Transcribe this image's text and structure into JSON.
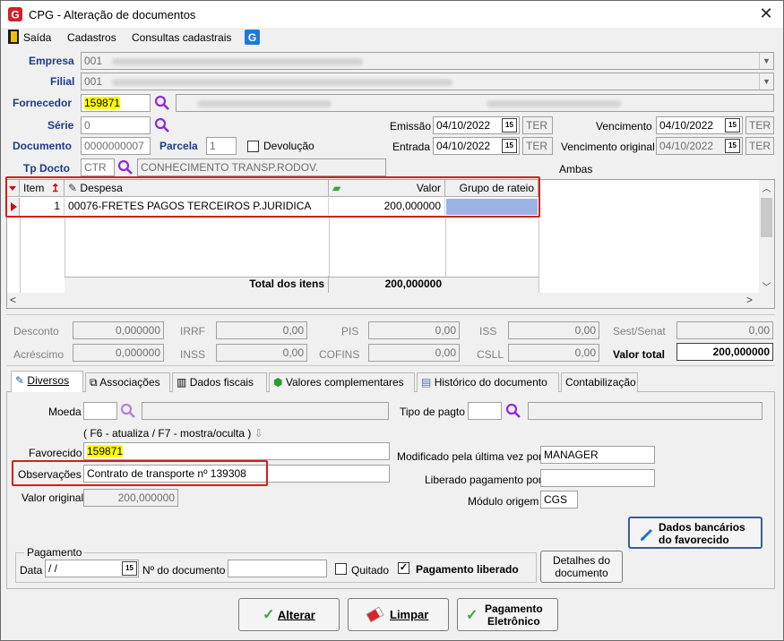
{
  "window": {
    "title": "CPG - Alteração de documentos",
    "close": "✕"
  },
  "menu": {
    "items": [
      "Saída",
      "Cadastros",
      "Consultas cadastrais"
    ]
  },
  "header": {
    "empresa_label": "Empresa",
    "empresa_code": "001",
    "filial_label": "Filial",
    "filial_code": "001",
    "fornecedor_label": "Fornecedor",
    "fornecedor_code": "159871",
    "serie_label": "Série",
    "serie_value": "0",
    "documento_label": "Documento",
    "documento_value": "0000000007",
    "parcela_label": "Parcela",
    "parcela_value": "1",
    "devolucao_label": "Devolução",
    "tpdocto_label": "Tp Docto",
    "tpdocto_code": "CTR",
    "tpdocto_desc": "CONHECIMENTO TRANSP.RODOV.",
    "emissao_label": "Emissão",
    "emissao_date": "04/10/2022",
    "emissao_day": "TER",
    "entrada_label": "Entrada",
    "entrada_date": "04/10/2022",
    "entrada_day": "TER",
    "vencimento_label": "Vencimento",
    "vencimento_date": "04/10/2022",
    "vencimento_day": "TER",
    "vencorig_label": "Vencimento original",
    "vencorig_date": "04/10/2022",
    "vencorig_day": "TER",
    "ambas_label": "Ambas",
    "cal_icon_text": "15"
  },
  "grid": {
    "columns": [
      "Item",
      "Despesa",
      "Valor",
      "Grupo de rateio"
    ],
    "rows": [
      {
        "item": "1",
        "despesa": "00076-FRETES PAGOS TERCEIROS P.JURIDICA",
        "valor": "200,000000",
        "grupo": ""
      }
    ],
    "total_label": "Total dos itens",
    "total_value": "200,000000"
  },
  "taxes": {
    "desconto_label": "Desconto",
    "desconto": "0,000000",
    "acrescimo_label": "Acréscimo",
    "acrescimo": "0,000000",
    "irrf_label": "IRRF",
    "irrf": "0,00",
    "inss_label": "INSS",
    "inss": "0,00",
    "pis_label": "PIS",
    "pis": "0,00",
    "cofins_label": "COFINS",
    "cofins": "0,00",
    "iss_label": "ISS",
    "iss": "0,00",
    "csll_label": "CSLL",
    "csll": "0,00",
    "sest_label": "Sest/Senat",
    "sest": "0,00",
    "total_label": "Valor total",
    "total": "200,000000"
  },
  "tabs": [
    "Diversos",
    "Associações",
    "Dados fiscais",
    "Valores complementares",
    "Histórico do documento",
    "Contabilização"
  ],
  "diversos": {
    "moeda_label": "Moeda",
    "tipo_pagto_label": "Tipo de pagto",
    "hint": "( F6 - atualiza / F7 - mostra/oculta )",
    "favorecido_label": "Favorecido",
    "favorecido_value": "159871",
    "observacoes_label": "Observações",
    "observacoes_value": "Contrato de transporte nº 139308",
    "valor_original_label": "Valor original",
    "valor_original_value": "200,000000",
    "modificado_label": "Modificado pela última vez por",
    "modificado_value": "MANAGER",
    "liberado_label": "Liberado pagamento por",
    "liberado_value": "",
    "modulo_label": "Módulo origem",
    "modulo_value": "CGS",
    "dados_bancarios_line1": "Dados bancários",
    "dados_bancarios_line2": "do favorecido",
    "pagamento_group": "Pagamento",
    "data_label": "Data",
    "data_value": " /  /",
    "ndoc_label": "Nº do documento",
    "ndoc_value": "",
    "quitado_label": "Quitado",
    "pag_liberado_label": "Pagamento liberado",
    "detalhes_line1": "Detalhes do",
    "detalhes_line2": "documento"
  },
  "footer": {
    "alterar": "Alterar",
    "limpar": "Limpar",
    "pag_line1": "Pagamento",
    "pag_line2": "Eletrônico"
  },
  "colors": {
    "highlight": "#ffff00",
    "label_blue": "#1f3a8a",
    "red_box": "#d0201a",
    "selected_cell": "#9db3e6"
  }
}
